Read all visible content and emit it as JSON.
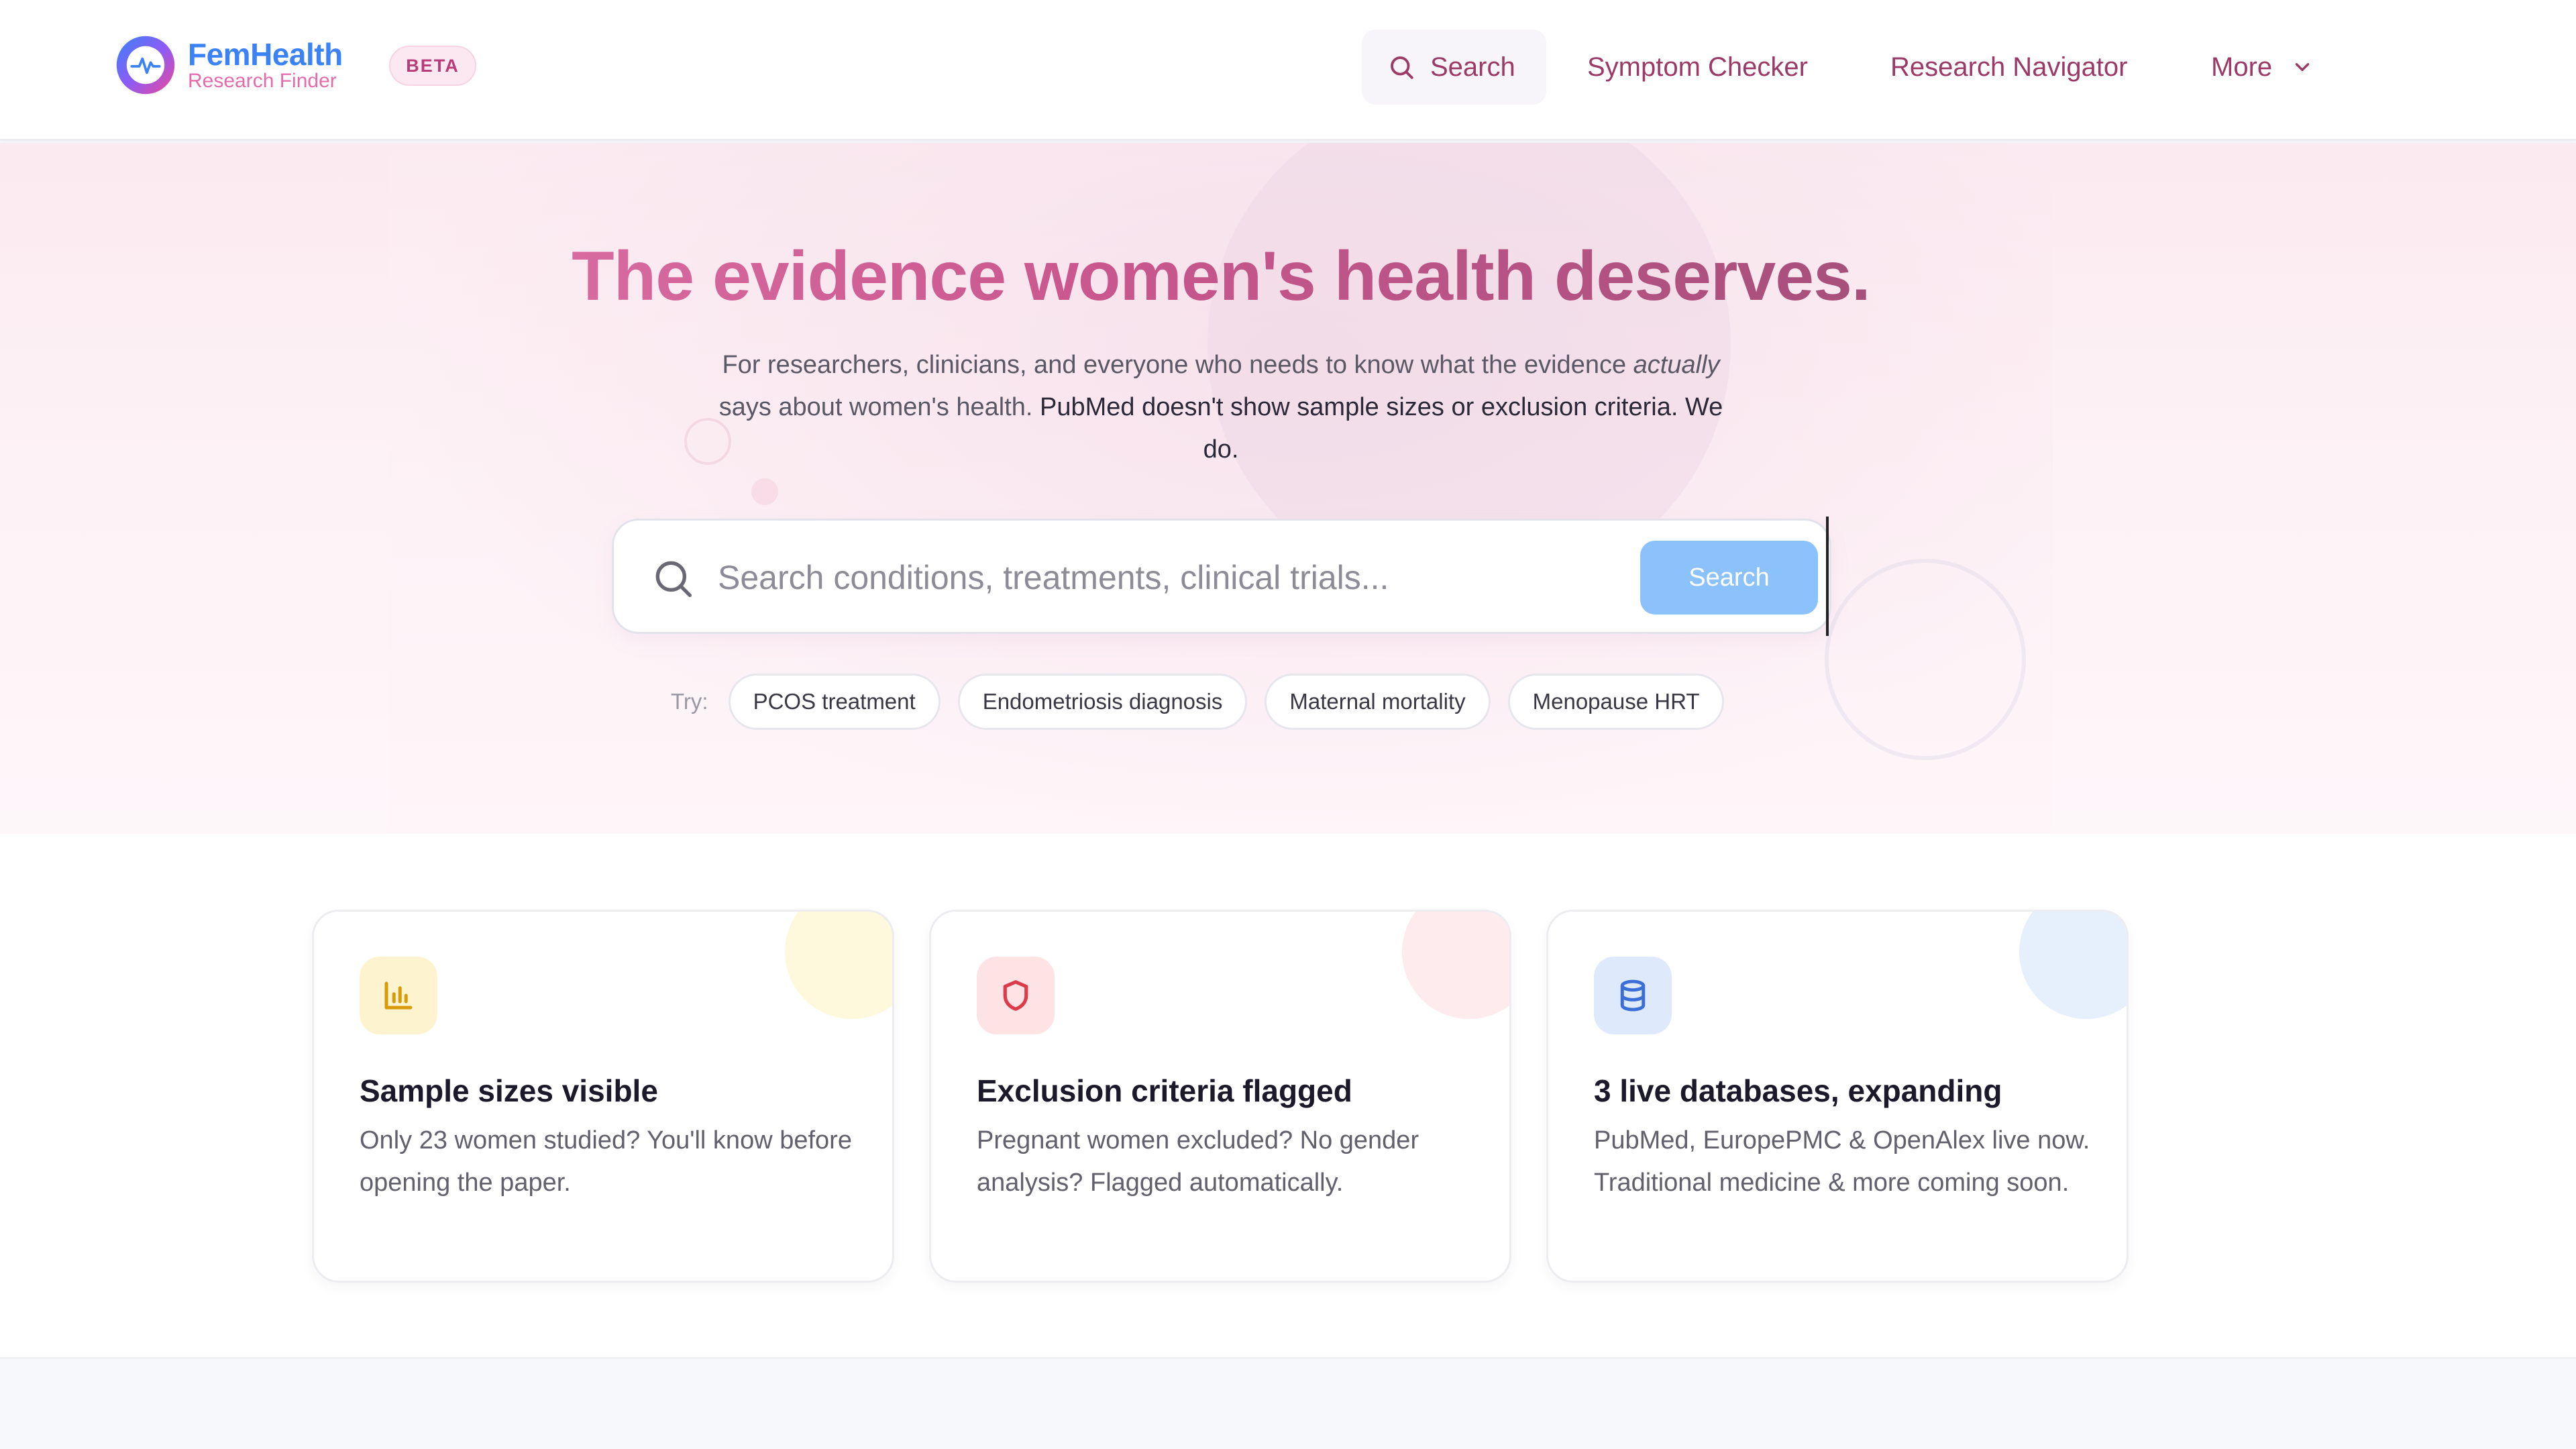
{
  "header": {
    "logo_name": "FemHealth",
    "logo_sub": "Research Finder",
    "beta": "BETA",
    "nav": {
      "search": "Search",
      "symptom_checker": "Symptom Checker",
      "research_navigator": "Research Navigator",
      "more": "More"
    }
  },
  "hero": {
    "headline": "The evidence women's health deserves.",
    "sub_line1": "For researchers, clinicians, and everyone who needs to know what the evidence",
    "sub_em": "actually",
    "sub_line2": " says about women's health. ",
    "sub_strong": "PubMed doesn't show sample sizes or exclusion criteria. We do.",
    "search": {
      "placeholder": "Search conditions, treatments, clinical trials...",
      "value": "",
      "button": "Search"
    },
    "try_label": "Try:",
    "suggestions": [
      "PCOS treatment",
      "Endometriosis diagnosis",
      "Maternal mortality",
      "Menopause HRT"
    ]
  },
  "features": [
    {
      "icon": "bar-chart-icon",
      "title": "Sample sizes visible",
      "text": "Only 23 women studied? You'll know before opening the paper.",
      "accent": "#f2b20d"
    },
    {
      "icon": "shield-icon",
      "title": "Exclusion criteria flagged",
      "text": "Pregnant women excluded? No gender analysis? Flagged automatically.",
      "accent": "#dc3b4a"
    },
    {
      "icon": "database-icon",
      "title": "3 live databases, expanding",
      "text": "PubMed, EuropePMC & OpenAlex live now. Traditional medicine & more coming soon.",
      "accent": "#3b6fd8"
    }
  ],
  "colors": {
    "brand_blue": "#3b82f6",
    "brand_pink": "#e56bab",
    "nav_text": "#9b3a66",
    "search_button": "#8cc2fb"
  }
}
